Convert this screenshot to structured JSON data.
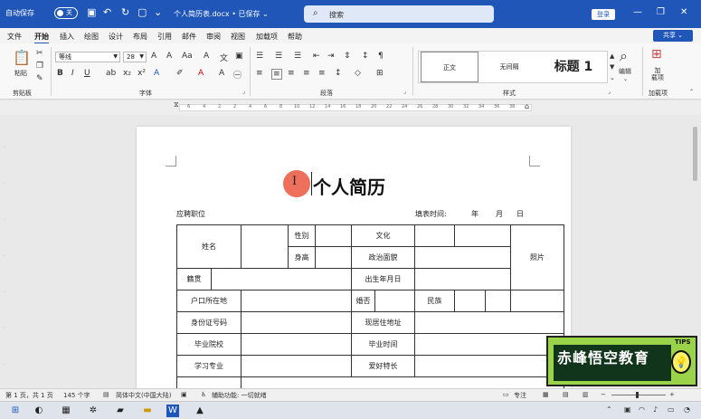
{
  "titlebar": {
    "autosave_label": "自动保存",
    "autosave_state": "关",
    "doc_title": "个人简历表.docx • 已保存 ⌄",
    "search_placeholder": "搜索",
    "login_label": "登录"
  },
  "menu": {
    "tabs": [
      "文件",
      "开始",
      "插入",
      "绘图",
      "设计",
      "布局",
      "引用",
      "邮件",
      "审阅",
      "视图",
      "加载项",
      "帮助"
    ],
    "active": "开始",
    "share_label": "共享 ⌄"
  },
  "ribbon": {
    "paste_label": "粘贴",
    "clipboard_label": "剪贴板",
    "font_name": "等线",
    "font_size": "28",
    "font_group_label": "字体",
    "paragraph_group_label": "段落",
    "styles_group_label": "样式",
    "styles": [
      "正文",
      "无间隔",
      "标题 1"
    ],
    "edit_label": "编辑",
    "addin_btn_label": "加\n载项",
    "addin_group_label": "加载项"
  },
  "ruler_marks": [
    "6",
    "4",
    "2",
    "2",
    "4",
    "6",
    "8",
    "10",
    "12",
    "14",
    "16",
    "18",
    "20",
    "22",
    "24",
    "26",
    "28",
    "30",
    "32",
    "34",
    "36",
    "38"
  ],
  "document": {
    "heading": "个人简历",
    "apply_position": "应聘职位",
    "fill_date": "填表时间:",
    "year": "年",
    "month": "月",
    "day": "日",
    "table": {
      "name": "姓名",
      "gender": "性别",
      "culture": "文化",
      "photo": "照片",
      "height": "身高",
      "politics": "政治面貌",
      "native_place": "籍贯",
      "birth_date": "出生年月日",
      "household": "户口所在地",
      "marital": "婚否",
      "ethnicity": "民族",
      "id_number": "身份证号码",
      "residence": "现居住地址",
      "school": "毕业院校",
      "grad_time": "毕业时间",
      "major": "学习专业",
      "hobbies": "爱好特长"
    }
  },
  "logo": {
    "text": "赤峰悟空教育",
    "tips": "TIPS"
  },
  "status": {
    "page": "第 1 页，共 1 页",
    "words": "145 个字",
    "language": "简体中文(中国大陆)",
    "accessibility": "辅助功能: 一切就绪",
    "focus": "专注"
  },
  "colors": {
    "accent": "#1f56b8",
    "logo_green": "#9ad24a",
    "cursor_red": "#ee6f5c"
  }
}
